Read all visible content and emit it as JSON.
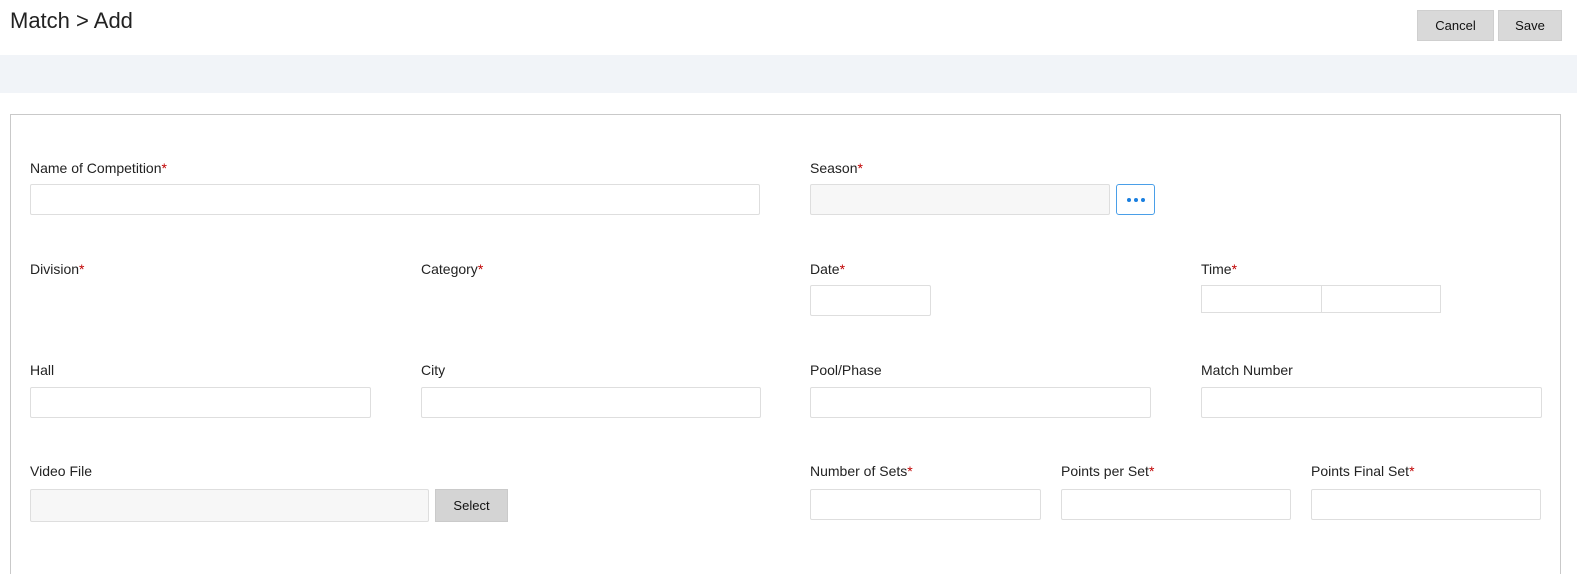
{
  "header": {
    "title": "Match > Add",
    "cancel_label": "Cancel",
    "save_label": "Save"
  },
  "form": {
    "required_mark": "*",
    "name_of_competition": {
      "label": "Name of Competition",
      "value": ""
    },
    "season": {
      "label": "Season",
      "value": "",
      "browse_icon": "ellipsis-icon"
    },
    "division": {
      "label": "Division"
    },
    "category": {
      "label": "Category"
    },
    "date": {
      "label": "Date",
      "value": ""
    },
    "time": {
      "label": "Time",
      "hours": "",
      "minutes": ""
    },
    "hall": {
      "label": "Hall",
      "value": ""
    },
    "city": {
      "label": "City",
      "value": ""
    },
    "pool_phase": {
      "label": "Pool/Phase",
      "value": ""
    },
    "match_number": {
      "label": "Match Number",
      "value": ""
    },
    "video_file": {
      "label": "Video File",
      "value": "",
      "select_label": "Select"
    },
    "number_of_sets": {
      "label": "Number of Sets",
      "value": ""
    },
    "points_per_set": {
      "label": "Points per Set",
      "value": ""
    },
    "points_final_set": {
      "label": "Points Final Set",
      "value": ""
    }
  },
  "colors": {
    "required": "#c00000",
    "accent": "#1a7fe0",
    "band": "#f1f4f8"
  }
}
